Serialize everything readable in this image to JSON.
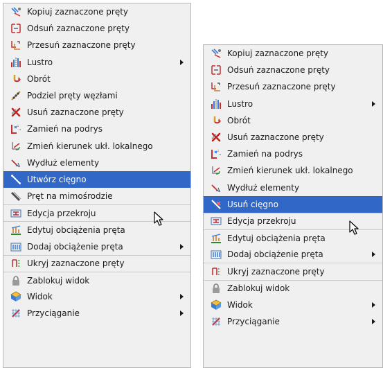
{
  "left_menu": {
    "items": [
      {
        "label": "Kopiuj zaznaczone pręty",
        "icon": "copy-bars-icon"
      },
      {
        "label": "Odsuń zaznaczone pręty",
        "icon": "offset-bars-icon"
      },
      {
        "label": "Przesuń zaznaczone pręty",
        "icon": "move-bars-icon"
      },
      {
        "label": "Lustro",
        "icon": "mirror-icon",
        "submenu": true
      },
      {
        "label": "Obrót",
        "icon": "rotate-icon"
      },
      {
        "label": "Podziel pręty węzłami",
        "icon": "divide-bars-icon"
      },
      {
        "label": "Usuń zaznaczone pręty",
        "icon": "delete-bars-icon"
      },
      {
        "label": "Zamień na podrys",
        "icon": "convert-underlay-icon"
      },
      {
        "label": "Zmień kierunek ukł. lokalnego",
        "icon": "local-axes-icon"
      },
      {
        "label": "Wydłuż elementy",
        "icon": "extend-elements-icon"
      },
      {
        "label": "Utwórz cięgno",
        "icon": "create-tendon-icon",
        "highlighted": true
      },
      {
        "label": "Pręt na mimośrodzie",
        "icon": "eccentric-bar-icon"
      },
      {
        "label": "Edycja przekroju",
        "icon": "section-edit-icon",
        "separator": true
      },
      {
        "label": "Edytuj obciążenia pręta",
        "icon": "edit-loads-icon",
        "separator": true
      },
      {
        "label": "Dodaj obciążenie pręta",
        "icon": "add-load-icon",
        "submenu": true
      },
      {
        "label": "Ukryj zaznaczone pręty",
        "icon": "hide-bars-icon",
        "separator": true
      },
      {
        "label": "Zablokuj widok",
        "icon": "lock-view-icon",
        "separator": true
      },
      {
        "label": "Widok",
        "icon": "view-icon",
        "submenu": true
      },
      {
        "label": "Przyciąganie",
        "icon": "snap-icon",
        "submenu": true
      }
    ]
  },
  "right_menu": {
    "items": [
      {
        "label": "Kopiuj zaznaczone pręty",
        "icon": "copy-bars-icon"
      },
      {
        "label": "Odsuń zaznaczone pręty",
        "icon": "offset-bars-icon"
      },
      {
        "label": "Przesuń zaznaczone pręty",
        "icon": "move-bars-icon"
      },
      {
        "label": "Lustro",
        "icon": "mirror-icon",
        "submenu": true
      },
      {
        "label": "Obrót",
        "icon": "rotate-icon"
      },
      {
        "label": "Usuń zaznaczone pręty",
        "icon": "delete-bars-icon"
      },
      {
        "label": "Zamień na podrys",
        "icon": "convert-underlay-icon"
      },
      {
        "label": "Zmień kierunek ukł. lokalnego",
        "icon": "local-axes-icon"
      },
      {
        "label": "Wydłuż elementy",
        "icon": "extend-elements-icon"
      },
      {
        "label": "Usuń cięgno",
        "icon": "delete-tendon-icon",
        "highlighted": true
      },
      {
        "label": "Edycja przekroju",
        "icon": "section-edit-icon",
        "separator": true
      },
      {
        "label": "Edytuj obciążenia pręta",
        "icon": "edit-loads-icon",
        "separator": true
      },
      {
        "label": "Dodaj obciążenie pręta",
        "icon": "add-load-icon",
        "submenu": true
      },
      {
        "label": "Ukryj zaznaczone pręty",
        "icon": "hide-bars-icon",
        "separator": true
      },
      {
        "label": "Zablokuj widok",
        "icon": "lock-view-icon",
        "separator": true
      },
      {
        "label": "Widok",
        "icon": "view-icon",
        "submenu": true
      },
      {
        "label": "Przyciąganie",
        "icon": "snap-icon",
        "submenu": true
      }
    ]
  },
  "colors": {
    "menu_bg": "#f0f0f0",
    "highlight_bg": "#3168c8",
    "highlight_text": "#ffffff",
    "text": "#1a1a1a"
  }
}
